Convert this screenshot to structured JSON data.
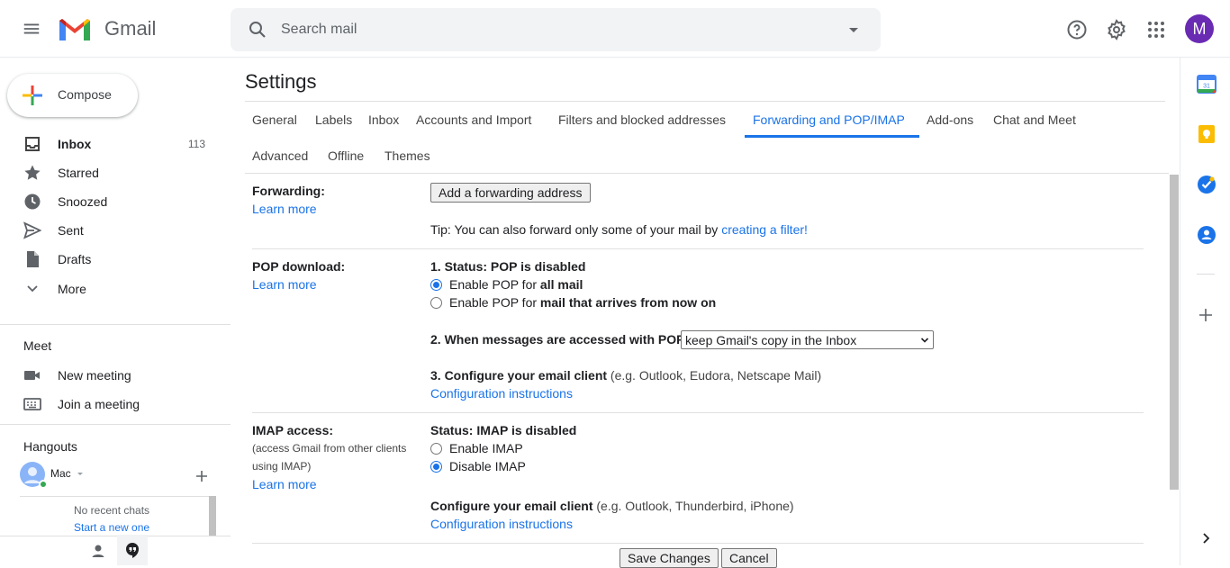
{
  "app": {
    "name": "Gmail"
  },
  "header": {
    "search_placeholder": "Search mail",
    "avatar_initial": "M"
  },
  "nav": {
    "compose_label": "Compose",
    "items": [
      {
        "label": "Inbox",
        "count": "113",
        "icon": "inbox-icon"
      },
      {
        "label": "Starred",
        "count": "",
        "icon": "star-icon"
      },
      {
        "label": "Snoozed",
        "count": "",
        "icon": "clock-icon"
      },
      {
        "label": "Sent",
        "count": "",
        "icon": "send-icon"
      },
      {
        "label": "Drafts",
        "count": "",
        "icon": "file-icon"
      },
      {
        "label": "More",
        "count": "",
        "icon": "chevron-down-icon"
      }
    ],
    "meet": {
      "title": "Meet",
      "new_meeting": "New meeting",
      "join_meeting": "Join a meeting"
    },
    "hangouts": {
      "title": "Hangouts",
      "user": "Mac",
      "no_chats": "No recent chats",
      "start_new": "Start a new one"
    }
  },
  "settings": {
    "title": "Settings",
    "tabs_row1": [
      "General",
      "Labels",
      "Inbox",
      "Accounts and Import",
      "Filters and blocked addresses",
      "Forwarding and POP/IMAP",
      "Add-ons",
      "Chat and Meet"
    ],
    "tabs_row2": [
      "Advanced",
      "Offline",
      "Themes"
    ],
    "active_tab": "Forwarding and POP/IMAP",
    "forwarding": {
      "label": "Forwarding:",
      "learn_more": "Learn more",
      "add_button": "Add a forwarding address",
      "tip_prefix": "Tip: You can also forward only some of your mail by ",
      "tip_link": "creating a filter!"
    },
    "pop": {
      "label": "POP download:",
      "learn_more": "Learn more",
      "status": "1. Status: POP is disabled",
      "opt1_prefix": "Enable POP for ",
      "opt1_bold": "all mail",
      "opt2_prefix": "Enable POP for ",
      "opt2_bold": "mail that arrives from now on",
      "selected_option": 1,
      "step2_label": "2. When messages are accessed with POP",
      "step2_select": "keep Gmail's copy in the Inbox",
      "step3_label": "3. Configure your email client",
      "step3_hint": " (e.g. Outlook, Eudora, Netscape Mail)",
      "config_link": "Configuration instructions"
    },
    "imap": {
      "label": "IMAP access:",
      "desc1": "(access Gmail from other clients",
      "desc2": "using IMAP)",
      "learn_more": "Learn more",
      "status": "Status: IMAP is disabled",
      "enable": "Enable IMAP",
      "disable": "Disable IMAP",
      "selected_option": 2,
      "configure_label": "Configure your email client",
      "configure_hint": " (e.g. Outlook, Thunderbird, iPhone)",
      "config_link": "Configuration instructions"
    },
    "buttons": {
      "save": "Save Changes",
      "cancel": "Cancel"
    }
  },
  "colors": {
    "accent": "#1a73e8",
    "avatar": "#6a2bb3",
    "online": "#34a853"
  }
}
